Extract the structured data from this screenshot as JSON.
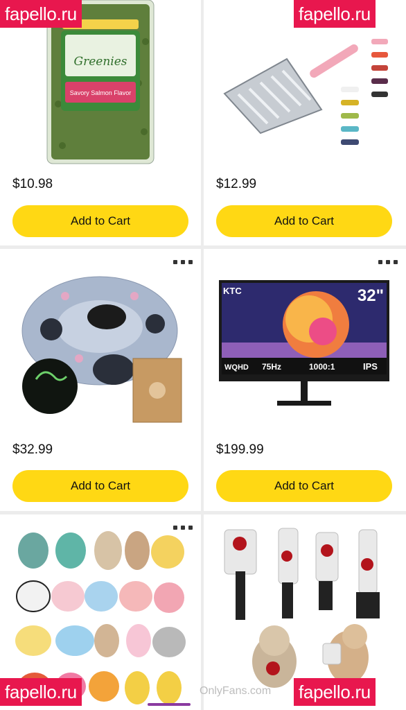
{
  "products": [
    {
      "price": "$10.98",
      "button": "Add to Cart",
      "image": "cat-treat-tub",
      "brand_text": "Greenies",
      "label_text": "Savory Salmon Flavor"
    },
    {
      "price": "$12.99",
      "button": "Add to Cart",
      "image": "litter-scoop"
    },
    {
      "price": "$32.99",
      "button": "Add to Cart",
      "image": "cat-tunnel-bed"
    },
    {
      "price": "$199.99",
      "button": "Add to Cart",
      "image": "ktc-monitor",
      "monitor": {
        "brand": "KTC",
        "size": "32\"",
        "badges": [
          "WQHD",
          "75Hz",
          "1000:1",
          "IPS"
        ]
      }
    },
    {
      "image": "plush-cat-toys"
    },
    {
      "image": "knife-cat-toys"
    }
  ],
  "watermarks": {
    "text": "fapello.ru",
    "footer": "OnlyFans.com"
  },
  "colors": {
    "button": "#ffd814",
    "watermark": "#e8174e"
  }
}
